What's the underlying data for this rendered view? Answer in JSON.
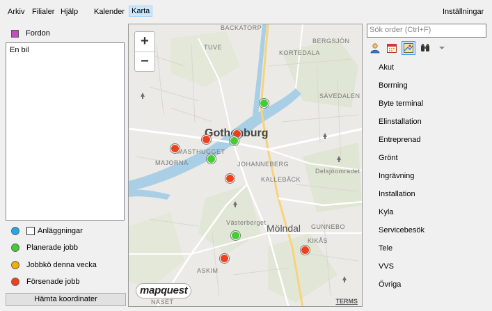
{
  "menu": {
    "arkiv": "Arkiv",
    "filialer": "Filialer",
    "hjalp": "Hjälp",
    "kalender": "Kalender",
    "karta": "Karta",
    "installningar": "Inställningar"
  },
  "left": {
    "fordon_label": "Fordon",
    "fordon_color": "#c04fc0",
    "list_items": [
      "En bil"
    ],
    "legend": [
      {
        "label": "Anläggningar",
        "color": "#1fa8f0",
        "has_checkbox": true,
        "checked": false
      },
      {
        "label": "Planerade jobb",
        "color": "#44cc33"
      },
      {
        "label": "Jobbkö denna vecka",
        "color": "#f0b000"
      },
      {
        "label": "Försenade jobb",
        "color": "#f0401a"
      }
    ],
    "button_label": "Hämta koordinater"
  },
  "map": {
    "zoom_in": "+",
    "zoom_out": "−",
    "logo": "mapquest",
    "terms": "TERMS",
    "labels": {
      "backatorp": "BACKATORP",
      "tuve": "TUVE",
      "kortedala": "KORTEDALA",
      "bergsjon": "BERGSJÖN",
      "savedalen": "SÄVEDALEN",
      "gothenburg": "Gothenburg",
      "masthugget": "MASTHUGGET",
      "majorna": "MAJORNA",
      "johanneberg": "JOHANNEBERG",
      "kalleback": "KALLEBÄCK",
      "delsjoomradet": "Delsjöomradet",
      "vasterberget": "Västerberget",
      "molndal": "Mölndal",
      "gunnebo": "GUNNEBO",
      "kikas": "KIKÅS",
      "askim": "ASKIM",
      "naset": "NASET"
    },
    "colors": {
      "planned": "#44cc33",
      "delayed": "#f0401a"
    }
  },
  "right": {
    "search_placeholder": "Sök order (Ctrl+F)",
    "categories": [
      "Akut",
      "Borrning",
      "Byte terminal",
      "Elinstallation",
      "Entreprenad",
      "Grönt",
      "Ingrävning",
      "Installation",
      "Kyla",
      "Servicebesök",
      "Tele",
      "VVS",
      "Övriga"
    ]
  }
}
